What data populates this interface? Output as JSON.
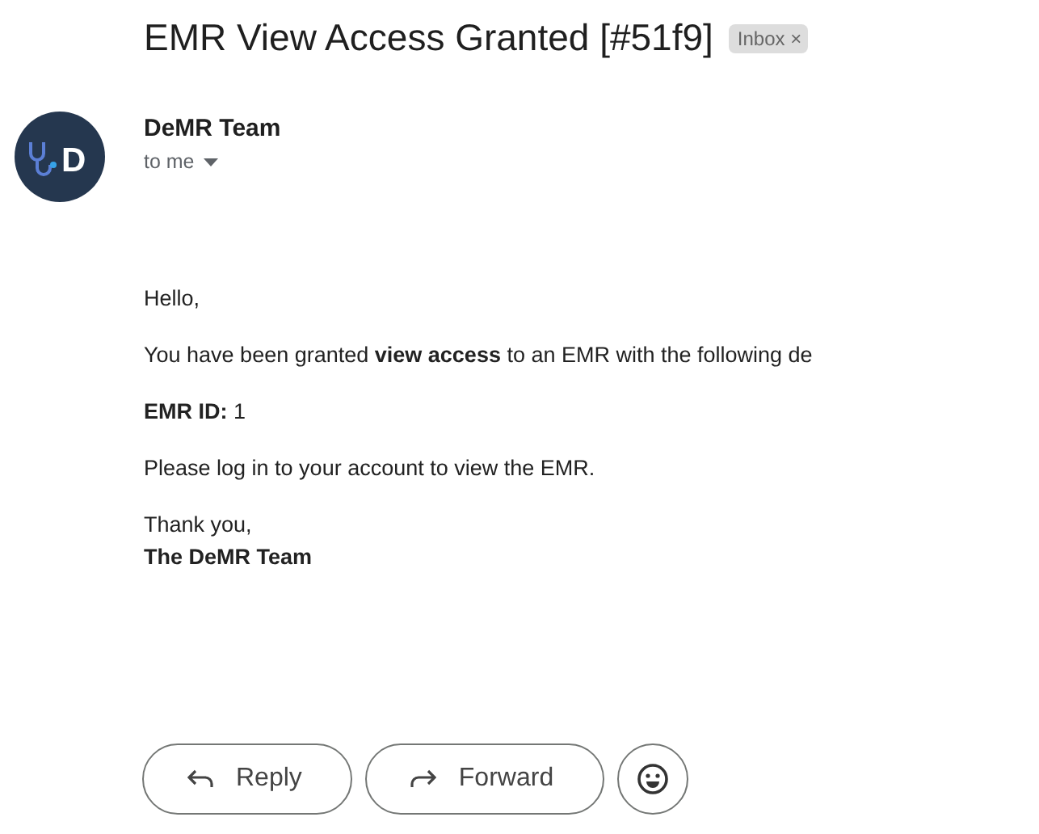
{
  "subject": "EMR View Access Granted [#51f9]",
  "label": {
    "text": "Inbox",
    "remove": "×"
  },
  "sender": {
    "name": "DeMR Team",
    "avatar_letter": "D",
    "recipient": "to me"
  },
  "body": [
    "Hello,",
    "You have been granted **view access** to an EMR with the following de",
    "**EMR ID:** 1",
    "Please log in to your account to view the EMR."
  ],
  "signoff": {
    "line": "Thank you,",
    "signature": "The DeMR Team"
  },
  "actions": [
    {
      "kind": "reply",
      "label": "Reply"
    },
    {
      "kind": "forward",
      "label": "Forward"
    },
    {
      "kind": "emoji"
    }
  ]
}
